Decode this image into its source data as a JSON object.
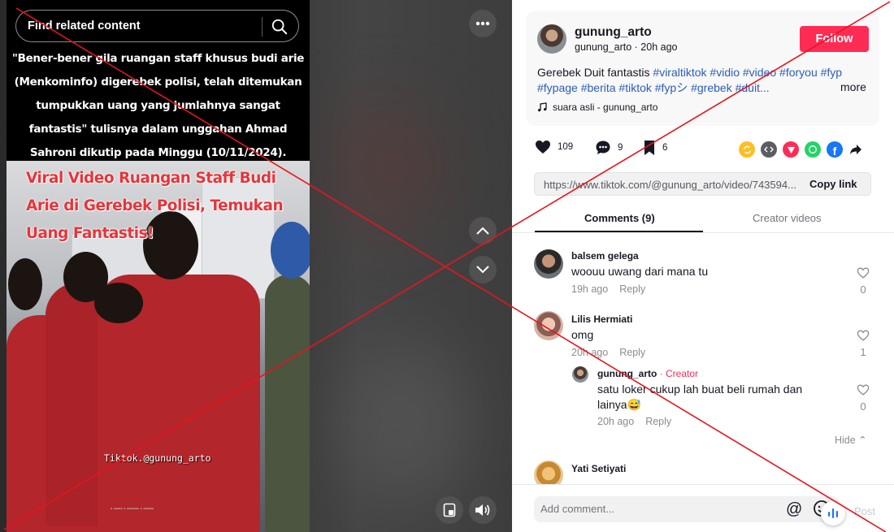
{
  "search": {
    "placeholder": "Find related content"
  },
  "video": {
    "caption": "\"Bener-bener gila ruangan staff khusus budi arie (Menkominfo) digerebek polisi, telah ditemukan tumpukkan uang yang jumlahnya sangat fantastis\" tulisnya dalam unggahan Ahmad Sahroni dikutip pada Minggu (10/11/2024).",
    "overlay_title": "Viral Video Ruangan Staff Budi Arie di Gerebek Polisi, Temukan Uang Fantastis!",
    "watermark": "Tiktok.@gunung_arto"
  },
  "post": {
    "author_name": "gunung_arto",
    "author_meta": "gunung_arto · 20h ago",
    "follow_label": "Follow",
    "desc_plain": "Gerebek Duit fantastis ",
    "desc_tags": "#viraltiktok #vidio #video #foryou #fyp #fypage #berita #tiktok #fypシ #grebek #duit...",
    "more_label": "more",
    "music": "suara asli - gunung_arto"
  },
  "actions": {
    "likes": "109",
    "comments": "9",
    "saves": "6"
  },
  "share": {
    "link": "https://www.tiktok.com/@gunung_arto/video/743594...",
    "copy_label": "Copy link"
  },
  "tabs": {
    "comments": "Comments (9)",
    "creator_videos": "Creator videos"
  },
  "comments": [
    {
      "name": "balsem gelega",
      "text": "woouu uwang dari mana tu",
      "time": "19h ago",
      "reply": "Reply",
      "likes": "0"
    },
    {
      "name": "Lilis Hermiati",
      "text": "omg",
      "time": "20h ago",
      "reply": "Reply",
      "likes": "1"
    },
    {
      "name": "gunung_arto",
      "creator_tag": "· Creator",
      "text": "satu loker cukup lah buat beli rumah dan lainya😅",
      "time": "20h ago",
      "reply": "Reply",
      "likes": "0"
    },
    {
      "name": "Yati Setiyati"
    }
  ],
  "hide_label": "Hide ⌃",
  "footer": {
    "placeholder": "Add comment...",
    "post_label": "Post"
  },
  "colors": {
    "accent": "#fe2c55",
    "hashtag": "#2b5db9",
    "cross": "#e8141c"
  }
}
